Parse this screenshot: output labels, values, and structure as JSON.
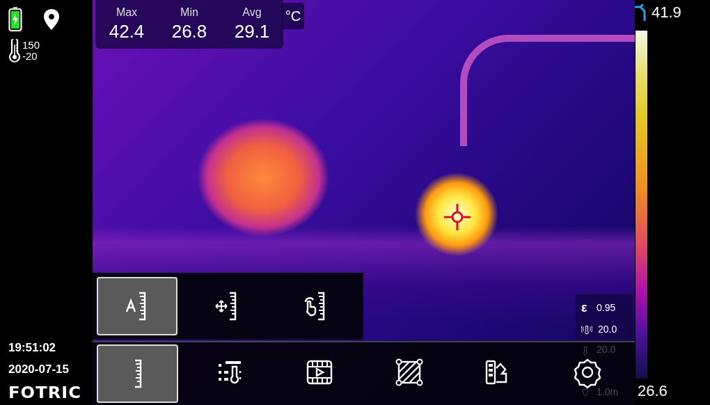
{
  "status": {
    "battery_charging": true
  },
  "range": {
    "high": "150",
    "low": "-20"
  },
  "clock": {
    "time": "19:51:02",
    "date": "2020-07-15"
  },
  "logo": "FOTRIC",
  "stats": [
    {
      "label": "Max",
      "value": "42.4"
    },
    {
      "label": "Min",
      "value": "26.8"
    },
    {
      "label": "Avg",
      "value": "29.1"
    }
  ],
  "unit": "°C",
  "scale": {
    "max": "41.9",
    "min": "26.6"
  },
  "params": [
    {
      "kind": "emissivity",
      "symbol": "ε",
      "value": "0.95",
      "obscured": false
    },
    {
      "kind": "reflected",
      "value": "20.0",
      "obscured": false
    },
    {
      "kind": "ambient",
      "value": "20.0",
      "obscured": true
    },
    {
      "kind": "distance",
      "value": "1.0m",
      "obscured": true
    }
  ],
  "submenu": [
    {
      "kind": "auto",
      "selected": true
    },
    {
      "kind": "move",
      "selected": false
    },
    {
      "kind": "touch",
      "selected": false
    }
  ],
  "toolbar": [
    {
      "kind": "ruler",
      "selected": true
    },
    {
      "kind": "list",
      "selected": false
    },
    {
      "kind": "video",
      "selected": false
    },
    {
      "kind": "area",
      "selected": false
    },
    {
      "kind": "palette",
      "selected": false
    },
    {
      "kind": "settings",
      "selected": false
    }
  ]
}
